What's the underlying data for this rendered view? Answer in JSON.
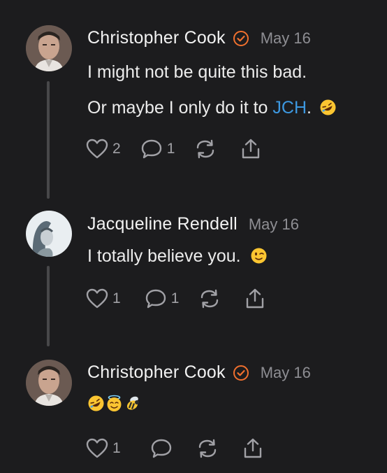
{
  "posts": [
    {
      "author": "Christopher Cook",
      "verified": true,
      "date": "May 16",
      "lines": [
        "I might not be quite this bad."
      ],
      "line2_prefix": "Or maybe I only do it to ",
      "mention": "JCH",
      "line2_suffix": ".",
      "emoji": [
        "rolling-on-floor-laughing"
      ],
      "likes": "2",
      "replies": "1"
    },
    {
      "author": "Jacqueline Rendell",
      "verified": false,
      "date": "May 16",
      "lines": [
        "I totally believe you."
      ],
      "emoji": [
        "winking-face"
      ],
      "likes": "1",
      "replies": "1"
    },
    {
      "author": "Christopher Cook",
      "verified": true,
      "date": "May 16",
      "emoji": [
        "rolling-on-floor-laughing",
        "smiling-face-with-halo",
        "honeybee"
      ],
      "likes": "1",
      "replies": ""
    }
  ],
  "colors": {
    "background": "#1c1c1e",
    "verified": "#f0702e",
    "mention": "#3d98e0",
    "muted": "#8e8e93"
  },
  "icons": [
    "heart-icon",
    "comment-icon",
    "repost-icon",
    "share-icon",
    "verified-badge-icon"
  ]
}
